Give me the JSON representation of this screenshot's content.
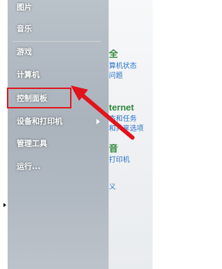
{
  "start_menu": {
    "items": [
      {
        "label": "图片",
        "interactable": true
      },
      {
        "label": "音乐",
        "interactable": true
      },
      {
        "label": "游戏",
        "interactable": true
      },
      {
        "label": "计算机",
        "interactable": true
      },
      {
        "label": "控制面板",
        "interactable": true
      },
      {
        "label": "设备和打印机",
        "interactable": true
      },
      {
        "label": "管理工具",
        "interactable": true,
        "has_submenu": true
      },
      {
        "label": "运行...",
        "interactable": true
      }
    ]
  },
  "right_pane": {
    "fragments": [
      {
        "text": "全",
        "style": "title"
      },
      {
        "text": "算机状态",
        "style": "link"
      },
      {
        "text": "问题",
        "style": "link"
      },
      {
        "text": "ternet",
        "style": "title"
      },
      {
        "text": "态和任务",
        "style": "link"
      },
      {
        "text": "和共享选项",
        "style": "link"
      },
      {
        "text": "音",
        "style": "title"
      },
      {
        "text": "打印机",
        "style": "link"
      },
      {
        "text": "义",
        "style": "link"
      }
    ]
  },
  "annotation": {
    "highlight_color": "#e1141b",
    "arrow_color": "#e1141b"
  }
}
